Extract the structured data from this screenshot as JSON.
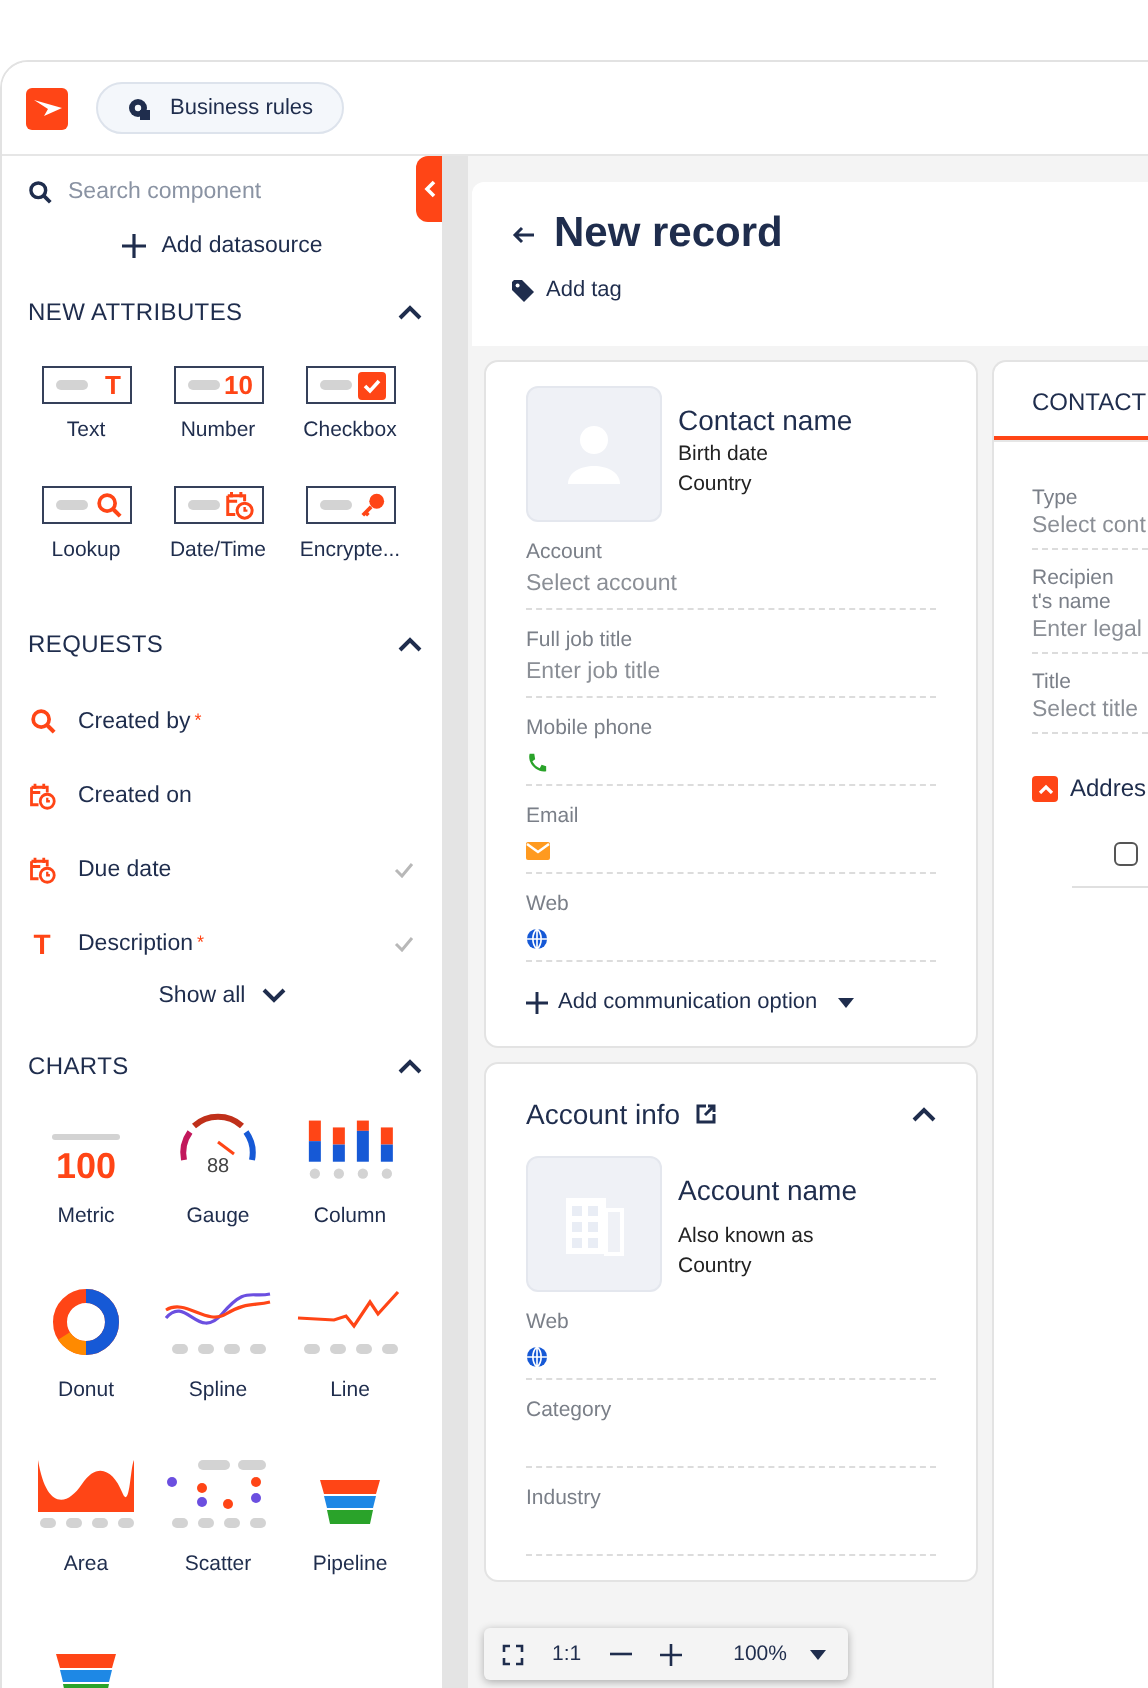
{
  "app_bar": {
    "business_rules": "Business rules"
  },
  "sidebar": {
    "search": {
      "placeholder": "Search component"
    },
    "add_datasource": "Add datasource",
    "attributes": {
      "title": "NEW ATTRIBUTES",
      "expanded": true,
      "items": [
        {
          "kind": "text",
          "label": "Text",
          "glyph": "T"
        },
        {
          "kind": "number",
          "label": "Number",
          "glyph": "10"
        },
        {
          "kind": "checkbox",
          "label": "Checkbox"
        },
        {
          "kind": "lookup",
          "label": "Lookup"
        },
        {
          "kind": "datetime",
          "label": "Date/Time"
        },
        {
          "kind": "encrypted",
          "label": "Encrypte..."
        }
      ]
    },
    "requests": {
      "title": "REQUESTS",
      "expanded": true,
      "items": [
        {
          "kind": "lookup",
          "label": "Created by",
          "required_mark": "*",
          "checked": false
        },
        {
          "kind": "datetime",
          "label": "Created on",
          "checked": false
        },
        {
          "kind": "datetime",
          "label": "Due date",
          "checked": true
        },
        {
          "kind": "text",
          "glyph": "T",
          "label": "Description",
          "required_mark": "*",
          "checked": true
        }
      ]
    },
    "show_all": "Show all",
    "charts": {
      "title": "CHARTS",
      "expanded": true,
      "items": [
        {
          "kind": "metric",
          "label": "Metric",
          "value": "100"
        },
        {
          "kind": "gauge",
          "label": "Gauge",
          "value": "88"
        },
        {
          "kind": "column",
          "label": "Column"
        },
        {
          "kind": "donut",
          "label": "Donut"
        },
        {
          "kind": "spline",
          "label": "Spline"
        },
        {
          "kind": "line",
          "label": "Line"
        },
        {
          "kind": "area",
          "label": "Area"
        },
        {
          "kind": "scatter",
          "label": "Scatter"
        },
        {
          "kind": "pipeline",
          "label": "Pipeline"
        },
        {
          "kind": "pipeline"
        }
      ]
    }
  },
  "record": {
    "title": "New record",
    "add_tag": "Add tag"
  },
  "contact_card": {
    "name": "Contact name",
    "details": [
      "Birth date",
      "Country"
    ],
    "fields": [
      {
        "label": "Account",
        "kind": "input",
        "placeholder": "Select account"
      },
      {
        "label": "Full job title",
        "kind": "input",
        "placeholder": "Enter job title"
      },
      {
        "label": "Mobile phone",
        "kind": "phone"
      },
      {
        "label": "Email",
        "kind": "email"
      },
      {
        "label": "Web",
        "kind": "web"
      }
    ],
    "add_option": "Add communication option"
  },
  "account_card": {
    "title": "Account info",
    "expanded": true,
    "name": "Account name",
    "details": [
      "Also known as",
      "Country"
    ],
    "fields": [
      {
        "label": "Web",
        "kind": "web"
      },
      {
        "label": "Category",
        "kind": "empty"
      },
      {
        "label": "Industry",
        "kind": "empty"
      }
    ]
  },
  "side_card": {
    "tabs": [
      {
        "label": "CONTACT",
        "selected": true
      }
    ],
    "fields": [
      {
        "label": "Type",
        "placeholder": "Select cont"
      },
      {
        "label": "Recipient's name",
        "placeholder": "Enter legal"
      },
      {
        "label": "Title",
        "placeholder": "Select title"
      }
    ],
    "section": {
      "title": "Addres",
      "expanded": true
    },
    "checkbox": {
      "checked": false
    }
  },
  "zoom_bar": {
    "ratio": "1:1",
    "zoom": "100%"
  }
}
